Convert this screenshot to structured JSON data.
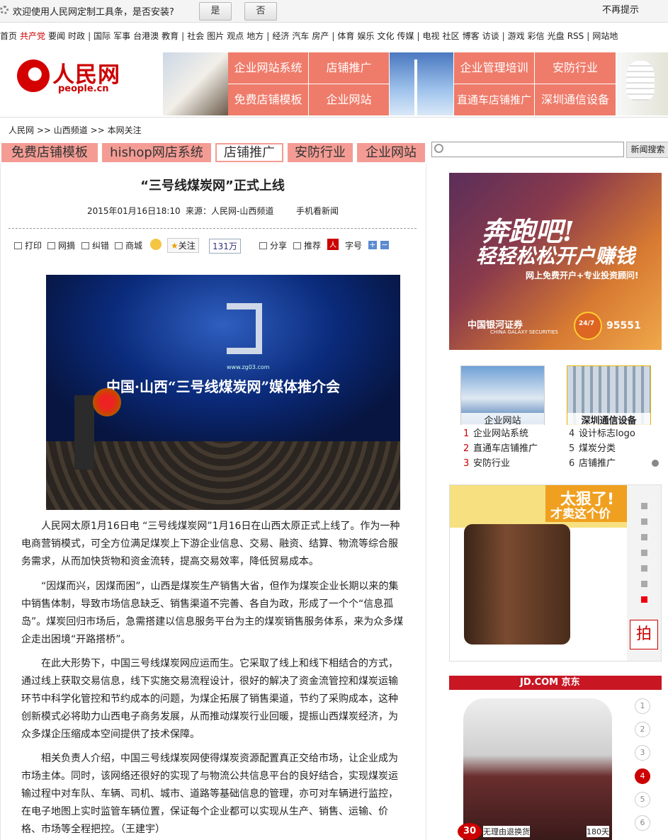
{
  "prompt": {
    "message": "欢迎使用人民网定制工具条，是否安装?",
    "yes": "是",
    "no": "否",
    "no_more": "不再提示"
  },
  "nav": {
    "group1": [
      "首页",
      "共产党",
      "要闻",
      "时政"
    ],
    "group2": [
      "国际",
      "军事",
      "台港澳",
      "教育"
    ],
    "group3": [
      "社会",
      "图片",
      "观点",
      "地方"
    ],
    "group4": [
      "经济",
      "汽车",
      "房产"
    ],
    "group5": [
      "体育",
      "娱乐",
      "文化",
      "传媒"
    ],
    "group6": [
      "电视",
      "社区",
      "博客",
      "访谈"
    ],
    "group7": [
      "游戏",
      "彩信",
      "光盘",
      "RSS"
    ],
    "group8": [
      "网站地"
    ]
  },
  "logo": {
    "name": "人民网",
    "url": "people.cn"
  },
  "header_links": {
    "left": [
      "企业网站系统",
      "店铺推广",
      "免费店铺模板",
      "企业网站"
    ],
    "right": [
      "企业管理培训",
      "安防行业",
      "直通车店铺推广",
      "深圳通信设备"
    ]
  },
  "breadcrumb": [
    "人民网",
    ">>",
    "山西频道",
    ">>",
    "本网关注"
  ],
  "tabs": [
    "免费店铺模板",
    "hishop网店系统",
    "店铺推广",
    "安防行业",
    "企业网站"
  ],
  "article": {
    "title": "“三号线煤炭网”正式上线",
    "date": "2015年01月16日18:10",
    "source": "来源：人民网-山西频道",
    "mobile": "手机看新闻",
    "tools": {
      "print": "打印",
      "wangzhai": "网摘",
      "jiucuo": "纠错",
      "shangcheng": "商城",
      "follow": "关注",
      "follow_count": "131万",
      "share": "分享",
      "recommend": "推荐",
      "font": "字号",
      "plus": "+",
      "minus": "−"
    },
    "image": {
      "url": "www.zg03.com",
      "headline": "中国·山西“三号线煤炭网”媒体推介会"
    },
    "paragraphs": [
      "人民网太原1月16日电 “三号线煤炭网”1月16日在山西太原正式上线了。作为一种电商营销模式，可全方位满足煤炭上下游企业信息、交易、融资、结算、物流等综合服务需求，从而加快货物和资金流转，提高交易效率，降低贸易成本。",
      "“因煤而兴，因煤而困”，山西是煤炭生产销售大省，但作为煤炭企业长期以来的集中销售体制，导致市场信息缺乏、销售渠道不完善、各自为政，形成了一个个“信息孤岛”。煤炭回归市场后，急需搭建以信息服务平台为主的煤炭销售服务体系，来为众多煤企走出困境“开路搭桥”。",
      "在此大形势下，中国三号线煤炭网应运而生。它采取了线上和线下相结合的方式，通过线上获取交易信息，线下实施交易流程设计，很好的解决了资金流管控和煤炭运输环节中科学化管控和节约成本的问题，为煤企拓展了销售渠道，节约了采购成本，这种创新模式必将助力山西电子商务发展，从而推动煤炭行业回暖，提振山西煤炭经济，为众多煤企压缩成本空间提供了技术保障。",
      "相关负责人介绍，中国三号线煤炭网使得煤炭资源配置真正交给市场，让企业成为市场主体。同时，该网络还很好的实现了与物流公共信息平台的良好结合，实现煤炭运输过程中对车队、车辆、司机、城市、道路等基础信息的管理，亦可对车辆进行监控，在电子地图上实时监管车辆位置，保证每个企业都可以实现从生产、销售、运输、价格、市场等全程把控。（王建宇）"
    ]
  },
  "sidebar": {
    "search_button": "新闻搜索",
    "ad1": {
      "line1": "奔跑吧!",
      "line2": "轻轻松松开户赚钱",
      "line3": "网上免费开户+专业投资顾问!",
      "bank": "中国银河证券",
      "bank_en": "CHINA GALAXY SECURITIES",
      "badge": "24/7",
      "phone": "95551"
    },
    "thumbs": [
      "企业网站",
      "深圳通信设备"
    ],
    "list_left": [
      {
        "n": "1",
        "t": "企业网站系统"
      },
      {
        "n": "2",
        "t": "直通车店铺推广"
      },
      {
        "n": "3",
        "t": "安防行业"
      }
    ],
    "list_right": [
      {
        "n": "4",
        "t": "设计标志logo"
      },
      {
        "n": "5",
        "t": "煤炭分类"
      },
      {
        "n": "6",
        "t": "店铺推广"
      }
    ],
    "ad2": {
      "t1": "太狠了!",
      "t2": "才卖这个价",
      "pai": "拍"
    },
    "ad3": {
      "brand": "JD.COM 京东",
      "nums": [
        "1",
        "2",
        "3",
        "4",
        "5",
        "6"
      ],
      "active": "4",
      "bottom1": "30",
      "bottom2": "无理由退换货",
      "bottom3": "180天"
    }
  }
}
